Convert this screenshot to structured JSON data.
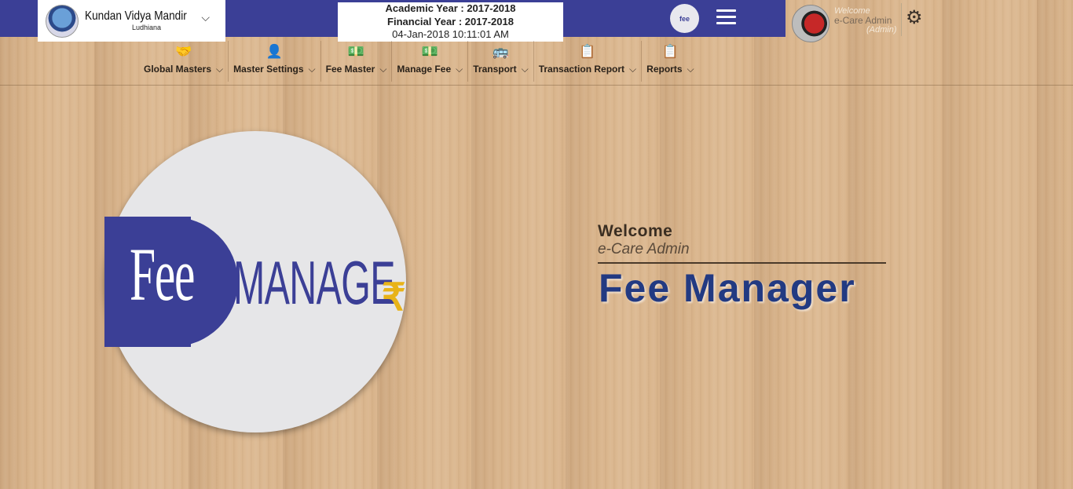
{
  "header": {
    "school_name": "Kundan Vidya Mandir",
    "school_city": "Ludhiana",
    "school_chevron": "⌵",
    "academic_year": "Academic Year : 2017-2018",
    "financial_year": "Financial Year : 2017-2018",
    "datetime": "04-Jan-2018 10:11:01 AM",
    "badge_text": "fee",
    "welcome": "Welcome",
    "user_name": "e-Care Admin",
    "user_role": "(Admin)"
  },
  "menu": {
    "items": [
      {
        "label": "Global Masters",
        "icon": "handshake-icon"
      },
      {
        "label": "Master Settings",
        "icon": "user-edit-icon"
      },
      {
        "label": "Fee Master",
        "icon": "money-icon"
      },
      {
        "label": "Manage Fee",
        "icon": "money-icon"
      },
      {
        "label": "Transport",
        "icon": "bus-icon"
      },
      {
        "label": "Transaction Report",
        "icon": "report-icon"
      },
      {
        "label": "Reports",
        "icon": "report-icon"
      }
    ],
    "dropdown_glyph": "⌵"
  },
  "logo": {
    "fee": "Fee",
    "manager": "MANAGE",
    "rupee": "₹"
  },
  "main": {
    "welcome": "Welcome",
    "user": "e-Care Admin",
    "app_title": "Fee Manager"
  },
  "colors": {
    "brand_blue": "#3b3f96",
    "title_blue": "#223a82",
    "rupee_gold": "#e8b318"
  }
}
